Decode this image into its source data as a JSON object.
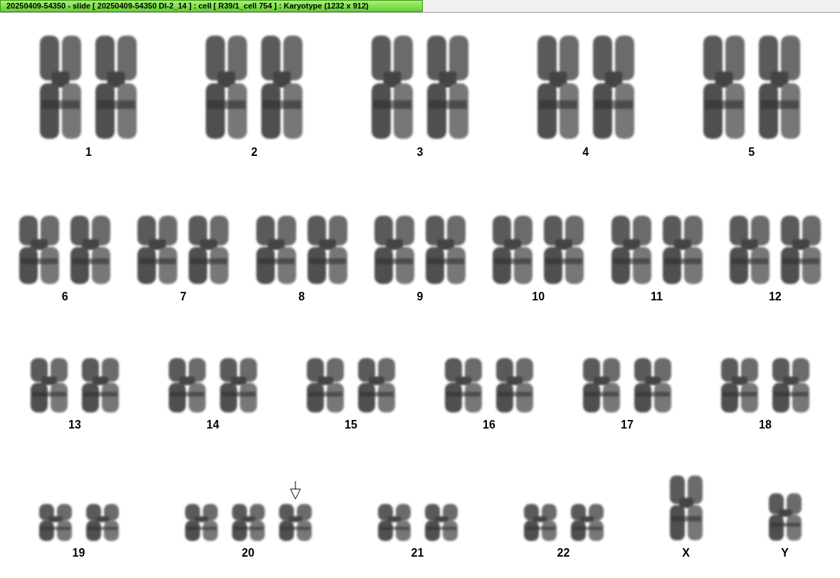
{
  "window": {
    "title": "20250409-54350 - slide [ 20250409-54350 DI-2_14 ] : cell [ R39/1_cell 754 ] : Karyotype  (1232 x 912)"
  },
  "karyotype": {
    "rows": [
      {
        "groups": [
          {
            "label": "1",
            "chromosomes": [
              {
                "marked": false
              },
              {
                "marked": false
              }
            ]
          },
          {
            "label": "2",
            "chromosomes": [
              {
                "marked": false
              },
              {
                "marked": false
              }
            ]
          },
          {
            "label": "3",
            "chromosomes": [
              {
                "marked": false
              },
              {
                "marked": false
              }
            ]
          },
          {
            "label": "4",
            "chromosomes": [
              {
                "marked": false
              },
              {
                "marked": false
              }
            ]
          },
          {
            "label": "5",
            "chromosomes": [
              {
                "marked": false
              },
              {
                "marked": false
              }
            ]
          }
        ]
      },
      {
        "groups": [
          {
            "label": "6",
            "chromosomes": [
              {
                "marked": false
              },
              {
                "marked": false
              }
            ]
          },
          {
            "label": "7",
            "chromosomes": [
              {
                "marked": false
              },
              {
                "marked": false
              }
            ]
          },
          {
            "label": "8",
            "chromosomes": [
              {
                "marked": false
              },
              {
                "marked": false
              }
            ]
          },
          {
            "label": "9",
            "chromosomes": [
              {
                "marked": false
              },
              {
                "marked": false
              }
            ]
          },
          {
            "label": "10",
            "chromosomes": [
              {
                "marked": false
              },
              {
                "marked": false
              }
            ]
          },
          {
            "label": "11",
            "chromosomes": [
              {
                "marked": false
              },
              {
                "marked": false
              }
            ]
          },
          {
            "label": "12",
            "chromosomes": [
              {
                "marked": false
              },
              {
                "marked": false
              }
            ]
          }
        ]
      },
      {
        "groups": [
          {
            "label": "13",
            "chromosomes": [
              {
                "marked": false
              },
              {
                "marked": false
              }
            ]
          },
          {
            "label": "14",
            "chromosomes": [
              {
                "marked": false
              },
              {
                "marked": false
              }
            ]
          },
          {
            "label": "15",
            "chromosomes": [
              {
                "marked": false
              },
              {
                "marked": false
              }
            ]
          },
          {
            "label": "16",
            "chromosomes": [
              {
                "marked": false
              },
              {
                "marked": false
              }
            ]
          },
          {
            "label": "17",
            "chromosomes": [
              {
                "marked": false
              },
              {
                "marked": false
              }
            ]
          },
          {
            "label": "18",
            "chromosomes": [
              {
                "marked": false
              },
              {
                "marked": false
              }
            ]
          }
        ]
      },
      {
        "groups": [
          {
            "label": "19",
            "chromosomes": [
              {
                "marked": false
              },
              {
                "marked": false
              }
            ]
          },
          {
            "label": "20",
            "chromosomes": [
              {
                "marked": false
              },
              {
                "marked": false
              },
              {
                "marked": true
              }
            ]
          },
          {
            "label": "21",
            "chromosomes": [
              {
                "marked": false
              },
              {
                "marked": false
              }
            ]
          },
          {
            "label": "22",
            "chromosomes": [
              {
                "marked": false
              },
              {
                "marked": false
              }
            ]
          },
          {
            "label": "X",
            "chromosomes": [
              {
                "marked": false
              }
            ]
          },
          {
            "label": "Y",
            "chromosomes": [
              {
                "marked": false
              }
            ]
          }
        ]
      }
    ]
  }
}
